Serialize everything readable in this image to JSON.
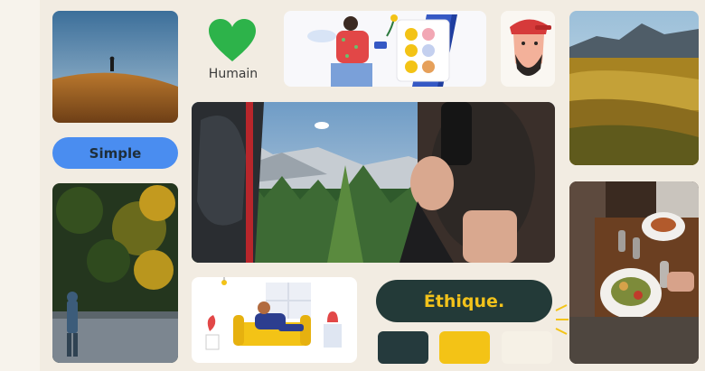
{
  "labels": {
    "humain": "Humain",
    "simple": "Simple",
    "ethique": "Éthique."
  },
  "icons": {
    "heart": "heart-icon"
  },
  "colors": {
    "background": "#f2ece2",
    "heart": "#2db34a",
    "simple_pill": "#4a8df0",
    "ethique_pill": "#233a38",
    "ethique_text": "#f2c21b",
    "swatch_dark": "#253a3d",
    "swatch_yellow": "#f3c316",
    "swatch_cream": "#f6f1e6"
  }
}
